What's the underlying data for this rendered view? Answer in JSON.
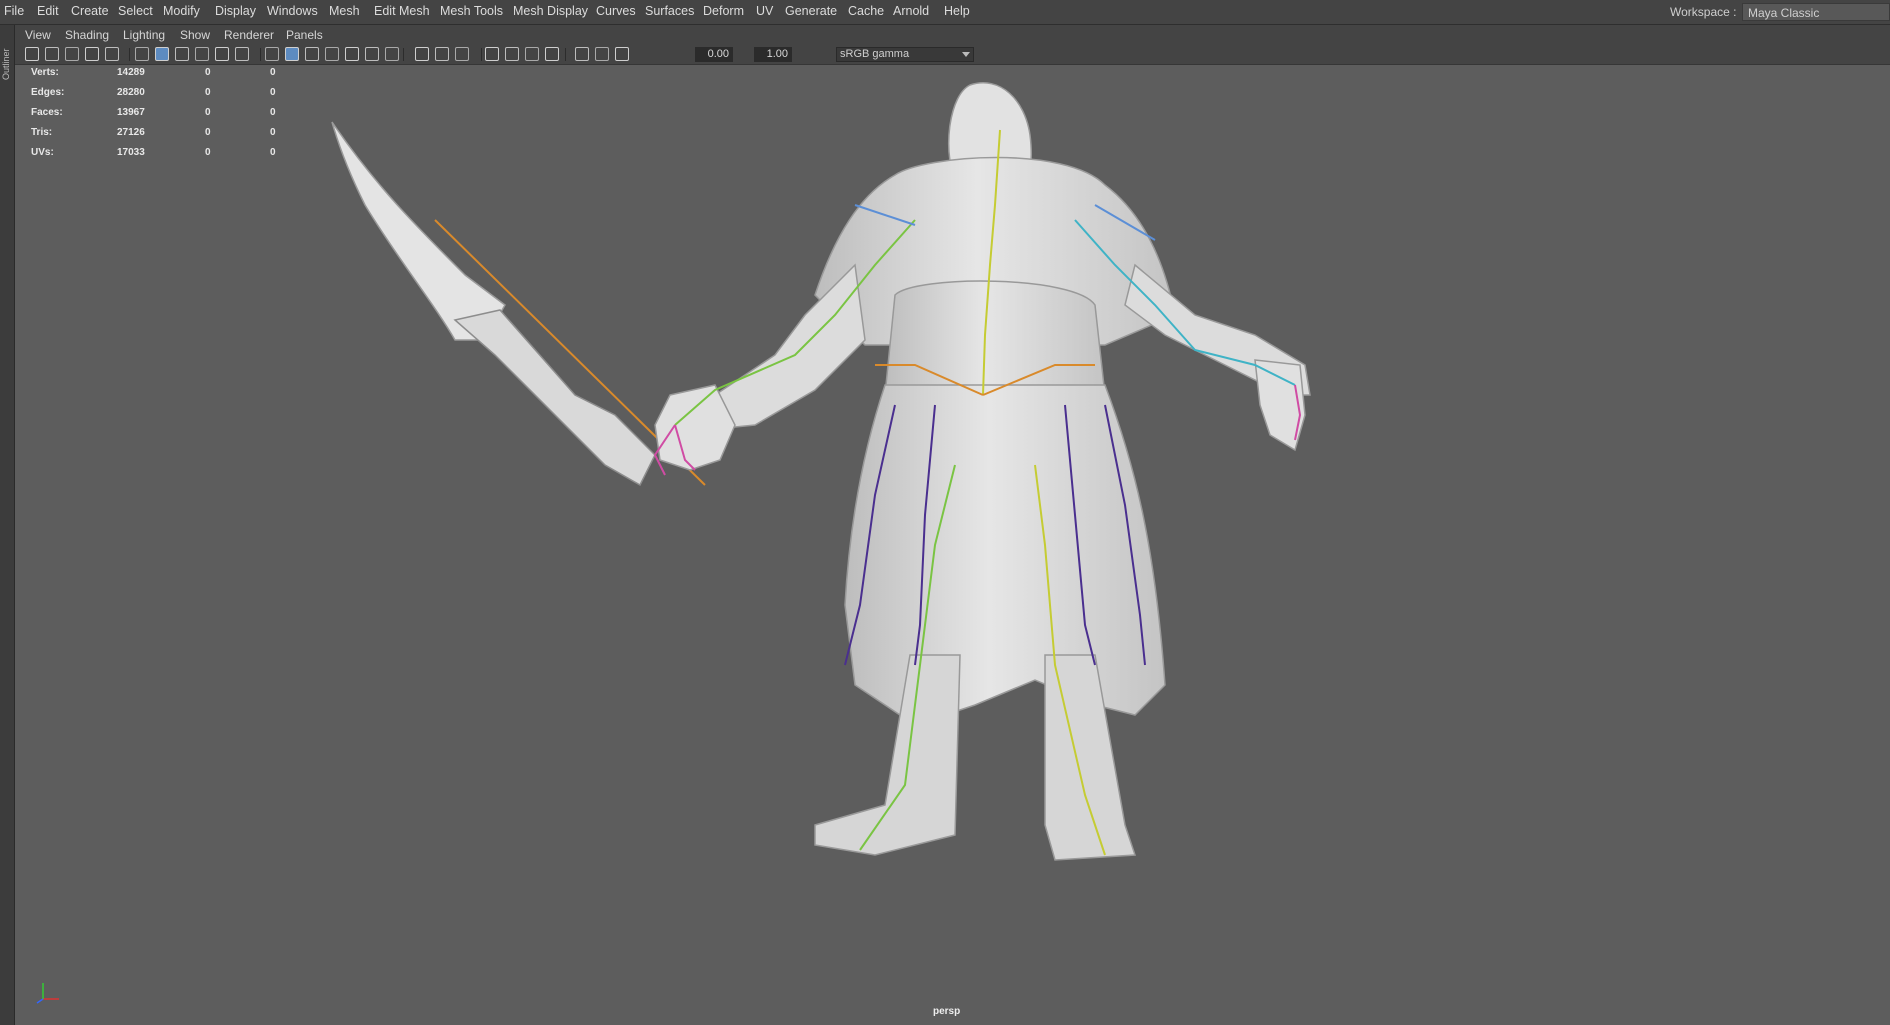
{
  "menubar": {
    "items": [
      "File",
      "Edit",
      "Create",
      "Select",
      "Modify",
      "Display",
      "Windows",
      "Mesh",
      "Edit Mesh",
      "Mesh Tools",
      "Mesh Display",
      "Curves",
      "Surfaces",
      "Deform",
      "UV",
      "Generate",
      "Cache",
      "Arnold",
      "Help"
    ],
    "workspace_label": "Workspace :",
    "workspace_value": "Maya Classic"
  },
  "sidebar": {
    "outliner_tab": "Outliner"
  },
  "panel_menu": {
    "items": [
      "View",
      "Shading",
      "Lighting",
      "Show",
      "Renderer",
      "Panels"
    ]
  },
  "toolbar": {
    "exposure_value": "0.00",
    "gamma_value": "1.00",
    "color_space": "sRGB gamma",
    "icons": [
      "camera-select-icon",
      "camera-attributes-icon",
      "bookmark-icon",
      "image-plane-icon",
      "grid-icon",
      "film-gate-icon",
      "resolution-gate-icon",
      "gate-mask-icon",
      "field-chart-icon",
      "safe-action-icon",
      "safe-title-icon",
      "wireframe-icon",
      "smooth-shade-icon",
      "default-material-icon",
      "textured-icon",
      "use-lights-icon",
      "shadows-icon",
      "ambient-occlusion-icon",
      "motion-blur-icon",
      "anti-aliasing-icon",
      "depth-of-field-icon",
      "isolate-select-icon",
      "xray-icon",
      "xray-joints-icon",
      "xray-components-icon",
      "exposure-icon",
      "gamma-icon",
      "color-management-icon"
    ]
  },
  "hud": {
    "rows": [
      {
        "label": "Verts:",
        "value": "14289",
        "selected": "0",
        "component": "0"
      },
      {
        "label": "Edges:",
        "value": "28280",
        "selected": "0",
        "component": "0"
      },
      {
        "label": "Faces:",
        "value": "13967",
        "selected": "0",
        "component": "0"
      },
      {
        "label": "Tris:",
        "value": "27126",
        "selected": "0",
        "component": "0"
      },
      {
        "label": "UVs:",
        "value": "17033",
        "selected": "0",
        "component": "0"
      }
    ]
  },
  "viewport": {
    "camera": "persp",
    "background": "#5d5d5d",
    "model_color": "#dedede",
    "joint_colors": [
      "#d98a2b",
      "#7ac443",
      "#c5cc33",
      "#3fb3c6",
      "#4a2f8f",
      "#d04ca4",
      "#5c8fd6"
    ]
  }
}
